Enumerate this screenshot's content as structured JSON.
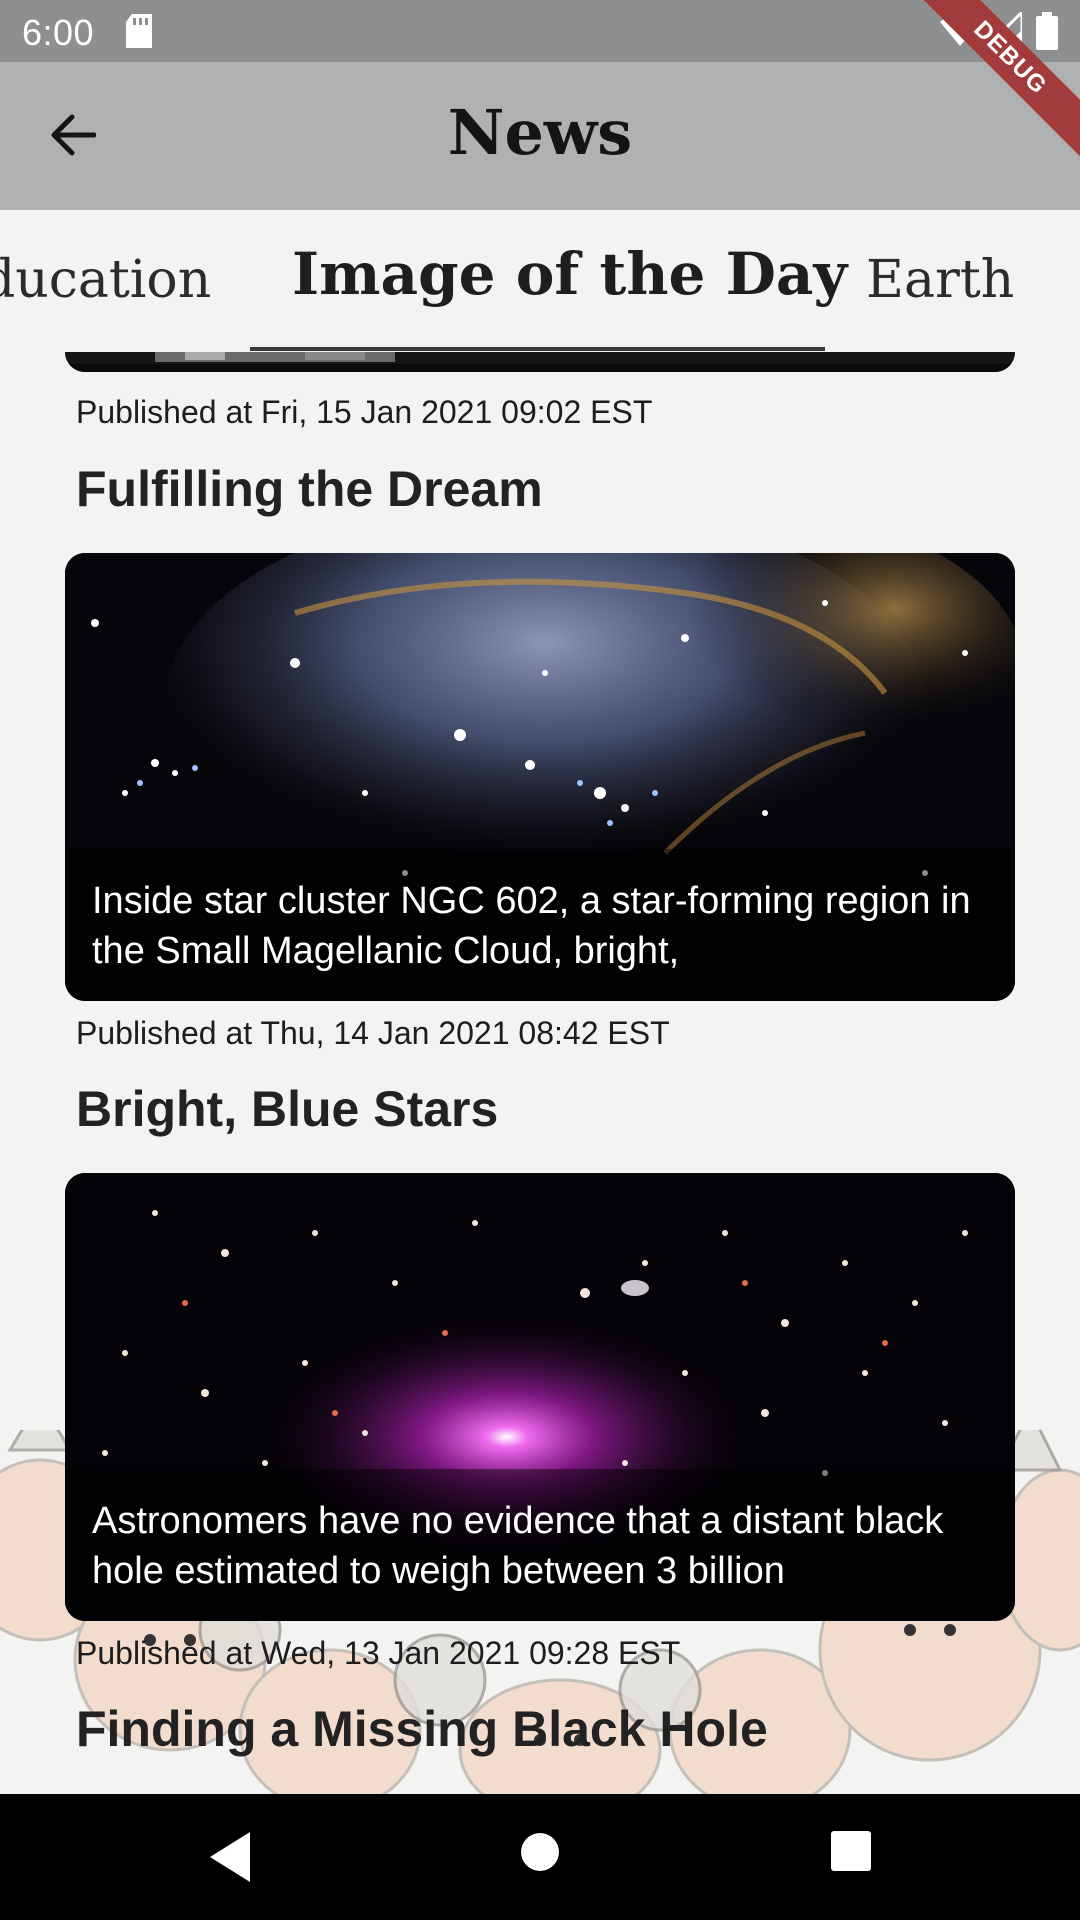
{
  "status_bar": {
    "time": "6:00",
    "icons": [
      "sd-card-icon",
      "wifi-icon",
      "signal-icon",
      "battery-icon"
    ],
    "debug_label": "DEBUG"
  },
  "app_bar": {
    "title": "News",
    "back_icon": "arrow-back-icon"
  },
  "tabs": [
    {
      "label": "ducation",
      "selected": false
    },
    {
      "label": "Image of the Day",
      "selected": true
    },
    {
      "label": "Earth",
      "selected": false
    }
  ],
  "articles": [
    {
      "published": "Published at Fri, 15 Jan 2021 09:02 EST",
      "title": "Fulfilling the Dream"
    },
    {
      "caption": "Inside star cluster NGC 602, a star-forming region in the Small Magellanic Cloud, bright,",
      "published": "Published at Thu, 14 Jan 2021 08:42 EST",
      "title": "Bright, Blue Stars"
    },
    {
      "caption": "Astronomers have no evidence that a distant black hole estimated to weigh between 3 billion",
      "published": "Published at Wed, 13 Jan 2021 09:28 EST",
      "title": "Finding a Missing Black Hole"
    }
  ],
  "nav_bar": {
    "icons": [
      "nav-back-icon",
      "nav-home-icon",
      "nav-recents-icon"
    ]
  },
  "colors": {
    "status_bar": "#8f8f8f",
    "app_bar": "#b1b1b1",
    "background": "#f3f3f2",
    "tab_indicator": "#3a3a3a",
    "debug_ribbon": "#a23b3b"
  }
}
